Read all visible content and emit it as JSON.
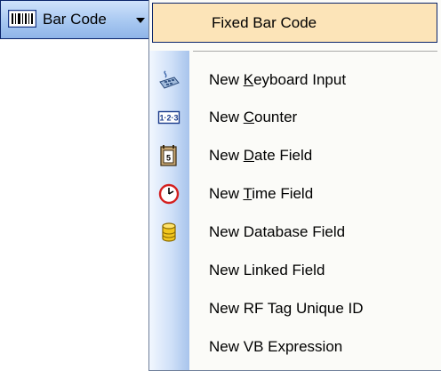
{
  "toolbar": {
    "label": "Bar Code",
    "icon": "barcode-icon"
  },
  "menu": {
    "highlighted_item": "Fixed Bar Code",
    "items": [
      {
        "pre": "New ",
        "mnemonic": "K",
        "post": "eyboard Input",
        "icon": "keyboard-input-icon"
      },
      {
        "pre": "New ",
        "mnemonic": "C",
        "post": "ounter",
        "icon": "counter-icon"
      },
      {
        "pre": "New ",
        "mnemonic": "D",
        "post": "ate Field",
        "icon": "calendar-icon"
      },
      {
        "pre": "New ",
        "mnemonic": "T",
        "post": "ime Field",
        "icon": "clock-icon"
      },
      {
        "text": "New Database Field",
        "icon": "database-icon"
      },
      {
        "text": "New Linked Field"
      },
      {
        "text": "New RF Tag Unique ID"
      },
      {
        "text": "New VB Expression"
      }
    ]
  },
  "colors": {
    "highlight_bg": "#fce4b8",
    "highlight_border": "#0a246a",
    "toolbar_blue": "#a8c8f1"
  }
}
